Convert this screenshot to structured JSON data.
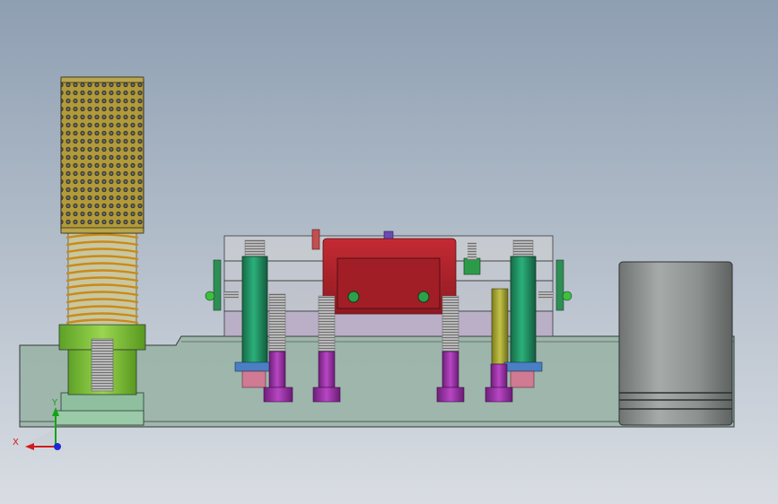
{
  "viewport": {
    "background_top": "#8e9fb2",
    "background_bottom": "#d7dbe2"
  },
  "triad": {
    "x_label": "X",
    "y_label": "Y",
    "x_color": "#d11b1b",
    "y_color": "#14a314",
    "z_color": "#1a2bd6"
  },
  "parts": [
    {
      "name": "base-plate",
      "color": "#96b0a0"
    },
    {
      "name": "ball-cage-guide-bushing",
      "color": "#3d3a26"
    },
    {
      "name": "compression-spring",
      "color": "#c98a1a"
    },
    {
      "name": "guide-post-collar",
      "color": "#7ec23a"
    },
    {
      "name": "guide-post-base",
      "color": "#8fbf9e"
    },
    {
      "name": "punch-holder-plate",
      "color": "#d6d6d6"
    },
    {
      "name": "stripper-plate",
      "color": "#b8aac4"
    },
    {
      "name": "red-die-block",
      "color": "#b3212a"
    },
    {
      "name": "green-guide-pin",
      "color": "#1e8c5e"
    },
    {
      "name": "magenta-socket-screw",
      "color": "#9c33a8"
    },
    {
      "name": "blue-washer",
      "color": "#4a7fc4"
    },
    {
      "name": "olive-pin",
      "color": "#9a9a2a"
    },
    {
      "name": "grey-cylinder",
      "color": "#8a8f8d"
    }
  ]
}
